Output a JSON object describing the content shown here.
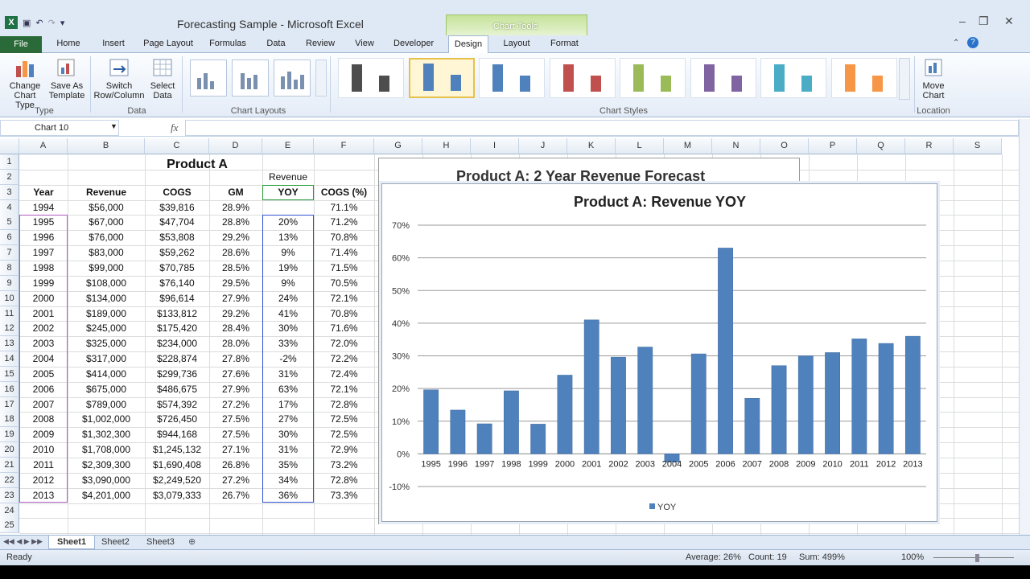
{
  "window": {
    "title": "Forecasting Sample  -  Microsoft Excel",
    "context_tab_group": "Chart Tools"
  },
  "tabs": [
    "File",
    "Home",
    "Insert",
    "Page Layout",
    "Formulas",
    "Data",
    "Review",
    "View",
    "Developer",
    "Design",
    "Layout",
    "Format"
  ],
  "active_tab": "Design",
  "ribbon": {
    "type_group": {
      "label": "Type",
      "change_chart_type": "Change\nChart Type",
      "save_as_template": "Save As\nTemplate"
    },
    "data_group": {
      "label": "Data",
      "switch_row_column": "Switch\nRow/Column",
      "select_data": "Select\nData"
    },
    "chart_layouts_label": "Chart Layouts",
    "chart_styles_label": "Chart Styles",
    "chart_style_colors": [
      "#4d4d4d",
      "#4f81bd",
      "#4f81bd",
      "#c0504d",
      "#9bbb59",
      "#8064a2",
      "#4bacc6",
      "#f79646"
    ],
    "location_group": {
      "label": "Location",
      "move_chart": "Move\nChart"
    }
  },
  "formula_bar": {
    "name_box": "Chart 10",
    "fx": "fx",
    "formula": ""
  },
  "columns": [
    "A",
    "B",
    "C",
    "D",
    "E",
    "F",
    "G",
    "H",
    "I",
    "J",
    "K",
    "L",
    "M",
    "N",
    "O",
    "P",
    "Q",
    "R",
    "S"
  ],
  "rows": [
    "1",
    "2",
    "3",
    "4",
    "5",
    "6",
    "7",
    "8",
    "9",
    "10",
    "11",
    "12",
    "13",
    "14",
    "15",
    "16",
    "17",
    "18",
    "19",
    "20",
    "21",
    "22",
    "23",
    "24",
    "25"
  ],
  "sheet": {
    "title": "Product A",
    "header_above": "Revenue",
    "headers": [
      "Year",
      "Revenue",
      "COGS",
      "GM",
      "YOY",
      "COGS (%)"
    ],
    "data": [
      [
        "1994",
        "$56,000",
        "$39,816",
        "28.9%",
        "",
        "71.1%"
      ],
      [
        "1995",
        "$67,000",
        "$47,704",
        "28.8%",
        "20%",
        "71.2%"
      ],
      [
        "1996",
        "$76,000",
        "$53,808",
        "29.2%",
        "13%",
        "70.8%"
      ],
      [
        "1997",
        "$83,000",
        "$59,262",
        "28.6%",
        "9%",
        "71.4%"
      ],
      [
        "1998",
        "$99,000",
        "$70,785",
        "28.5%",
        "19%",
        "71.5%"
      ],
      [
        "1999",
        "$108,000",
        "$76,140",
        "29.5%",
        "9%",
        "70.5%"
      ],
      [
        "2000",
        "$134,000",
        "$96,614",
        "27.9%",
        "24%",
        "72.1%"
      ],
      [
        "2001",
        "$189,000",
        "$133,812",
        "29.2%",
        "41%",
        "70.8%"
      ],
      [
        "2002",
        "$245,000",
        "$175,420",
        "28.4%",
        "30%",
        "71.6%"
      ],
      [
        "2003",
        "$325,000",
        "$234,000",
        "28.0%",
        "33%",
        "72.0%"
      ],
      [
        "2004",
        "$317,000",
        "$228,874",
        "27.8%",
        "-2%",
        "72.2%"
      ],
      [
        "2005",
        "$414,000",
        "$299,736",
        "27.6%",
        "31%",
        "72.4%"
      ],
      [
        "2006",
        "$675,000",
        "$486,675",
        "27.9%",
        "63%",
        "72.1%"
      ],
      [
        "2007",
        "$789,000",
        "$574,392",
        "27.2%",
        "17%",
        "72.8%"
      ],
      [
        "2008",
        "$1,002,000",
        "$726,450",
        "27.5%",
        "27%",
        "72.5%"
      ],
      [
        "2009",
        "$1,302,300",
        "$944,168",
        "27.5%",
        "30%",
        "72.5%"
      ],
      [
        "2010",
        "$1,708,000",
        "$1,245,132",
        "27.1%",
        "31%",
        "72.9%"
      ],
      [
        "2011",
        "$2,309,300",
        "$1,690,408",
        "26.8%",
        "35%",
        "73.2%"
      ],
      [
        "2012",
        "$3,090,000",
        "$2,249,520",
        "27.2%",
        "34%",
        "72.8%"
      ],
      [
        "2013",
        "$4,201,000",
        "$3,079,333",
        "26.7%",
        "36%",
        "73.3%"
      ]
    ]
  },
  "behind_chart": {
    "title": "Product A: 2 Year Revenue Forecast"
  },
  "chart_data": {
    "type": "bar",
    "title": "Product A: Revenue YOY",
    "categories": [
      "1995",
      "1996",
      "1997",
      "1998",
      "1999",
      "2000",
      "2001",
      "2002",
      "2003",
      "2004",
      "2005",
      "2006",
      "2007",
      "2008",
      "2009",
      "2010",
      "2011",
      "2012",
      "2013"
    ],
    "series": [
      {
        "name": "YOY",
        "values": [
          19.6,
          13.4,
          9.2,
          19.3,
          9.1,
          24.1,
          41.0,
          29.6,
          32.7,
          -2.5,
          30.6,
          63.0,
          17.0,
          27.0,
          30.0,
          31.0,
          35.2,
          33.8,
          36.0
        ],
        "color": "#4f81bd"
      }
    ],
    "y_ticks": [
      "70%",
      "60%",
      "50%",
      "40%",
      "30%",
      "20%",
      "10%",
      "0%",
      "-10%"
    ],
    "ylim": [
      -10,
      70
    ],
    "grid": true,
    "legend": "bottom"
  },
  "sheet_tabs": [
    "Sheet1",
    "Sheet2",
    "Sheet3"
  ],
  "active_sheet": "Sheet1",
  "status": {
    "ready": "Ready",
    "average": "Average: 26%",
    "count": "Count: 19",
    "sum": "Sum: 499%",
    "zoom": "100%"
  }
}
